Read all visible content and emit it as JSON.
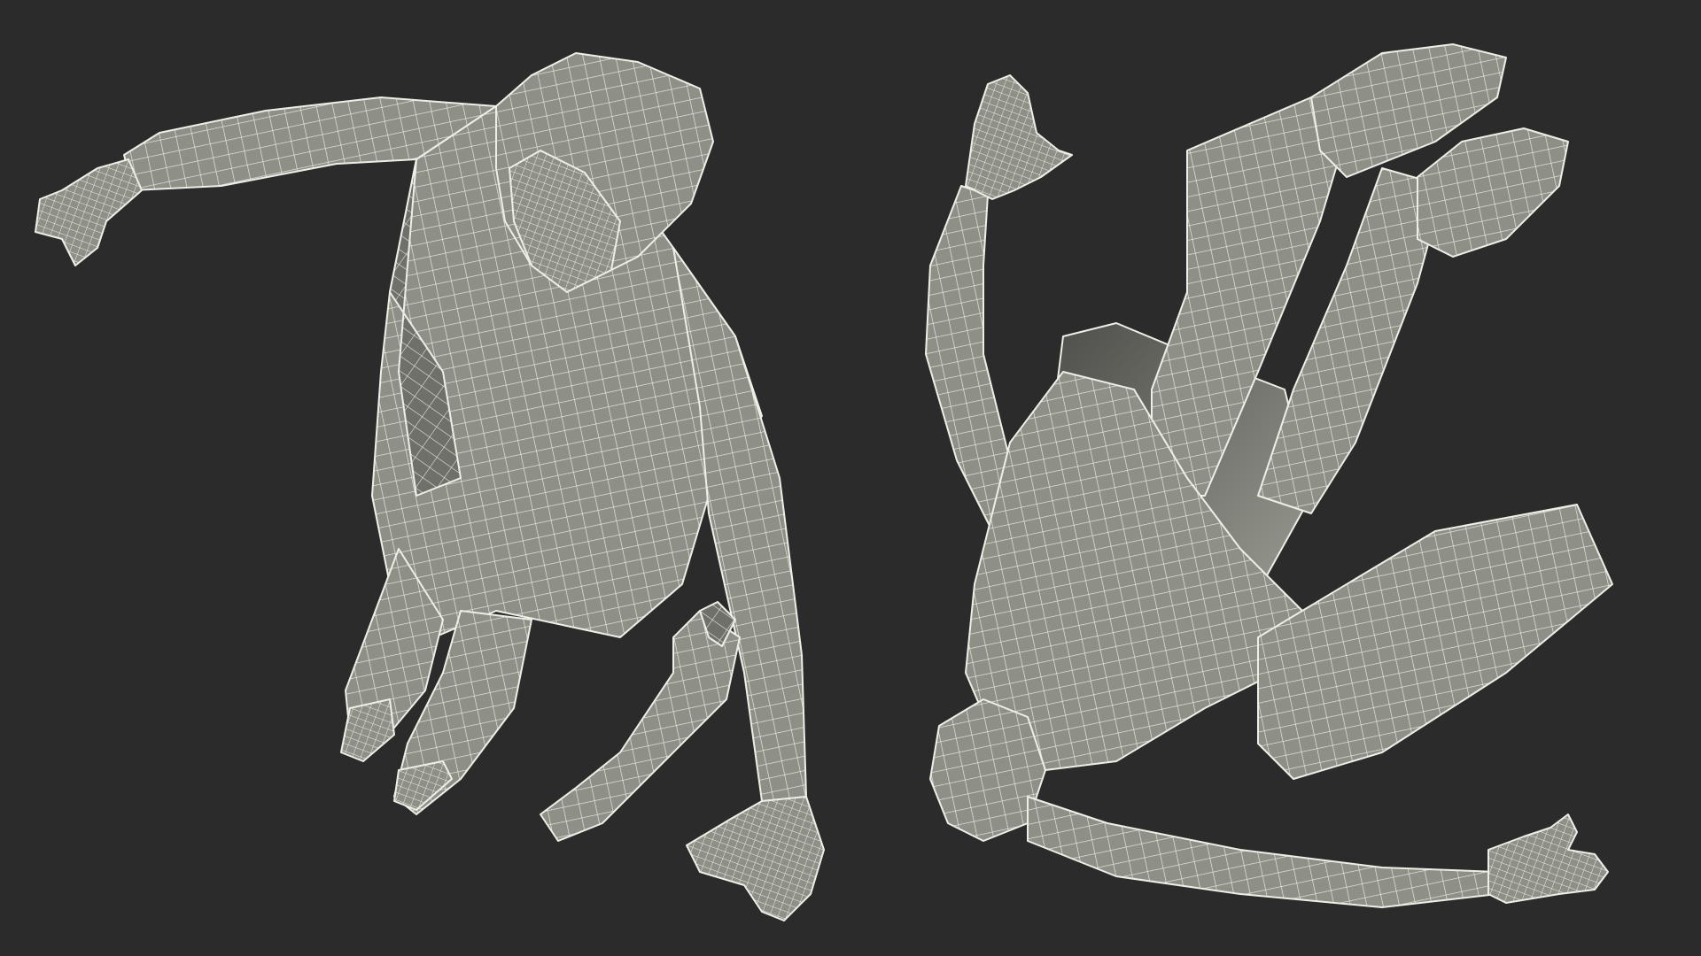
{
  "scene": {
    "background_color": "#2b2b2b",
    "mesh_fill_color": "#8e8f86",
    "mesh_shade_color": "#6f7069",
    "wire_color": "#eeeee6",
    "models": [
      {
        "name": "figure-top-view",
        "view": "top-down",
        "render": "wireframe"
      },
      {
        "name": "figure-bottom-view",
        "view": "bottom-up",
        "render": "wireframe"
      }
    ]
  }
}
